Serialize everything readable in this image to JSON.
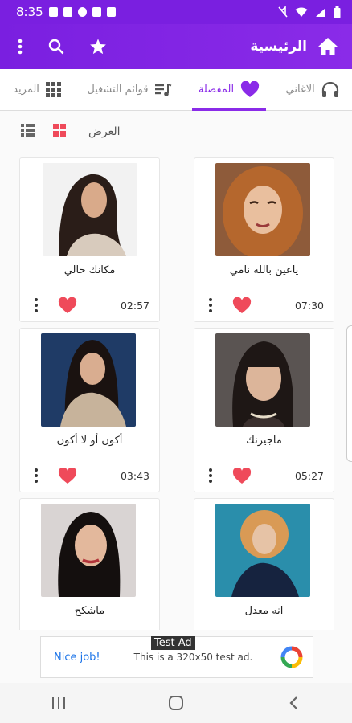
{
  "status_bar": {
    "time": "8:35"
  },
  "app_bar": {
    "title": "الرئيسية"
  },
  "tabs": [
    {
      "label": "الاغاني",
      "icon": "headphones-icon"
    },
    {
      "label": "المفضلة",
      "icon": "heart-icon",
      "active": true
    },
    {
      "label": "قوائم التشغيل",
      "icon": "playlist-icon"
    },
    {
      "label": "المزيد",
      "icon": "grid-icon"
    }
  ],
  "view": {
    "label": "العرض"
  },
  "songs": [
    {
      "title": "ياعين بالله نامي",
      "duration": "07:30"
    },
    {
      "title": "مكانك خالي",
      "duration": "02:57"
    },
    {
      "title": "ماجيرنك",
      "duration": "05:27"
    },
    {
      "title": "أكون أو لا أكون",
      "duration": "03:43"
    },
    {
      "title": "انه معدل",
      "duration": ""
    },
    {
      "title": "ماشكح",
      "duration": ""
    }
  ],
  "ad": {
    "badge": "Test Ad",
    "nice": "Nice job!",
    "text": "This is a 320x50 test ad."
  },
  "colors": {
    "primary": "#8a2be8",
    "heart": "#ef4a5a"
  }
}
